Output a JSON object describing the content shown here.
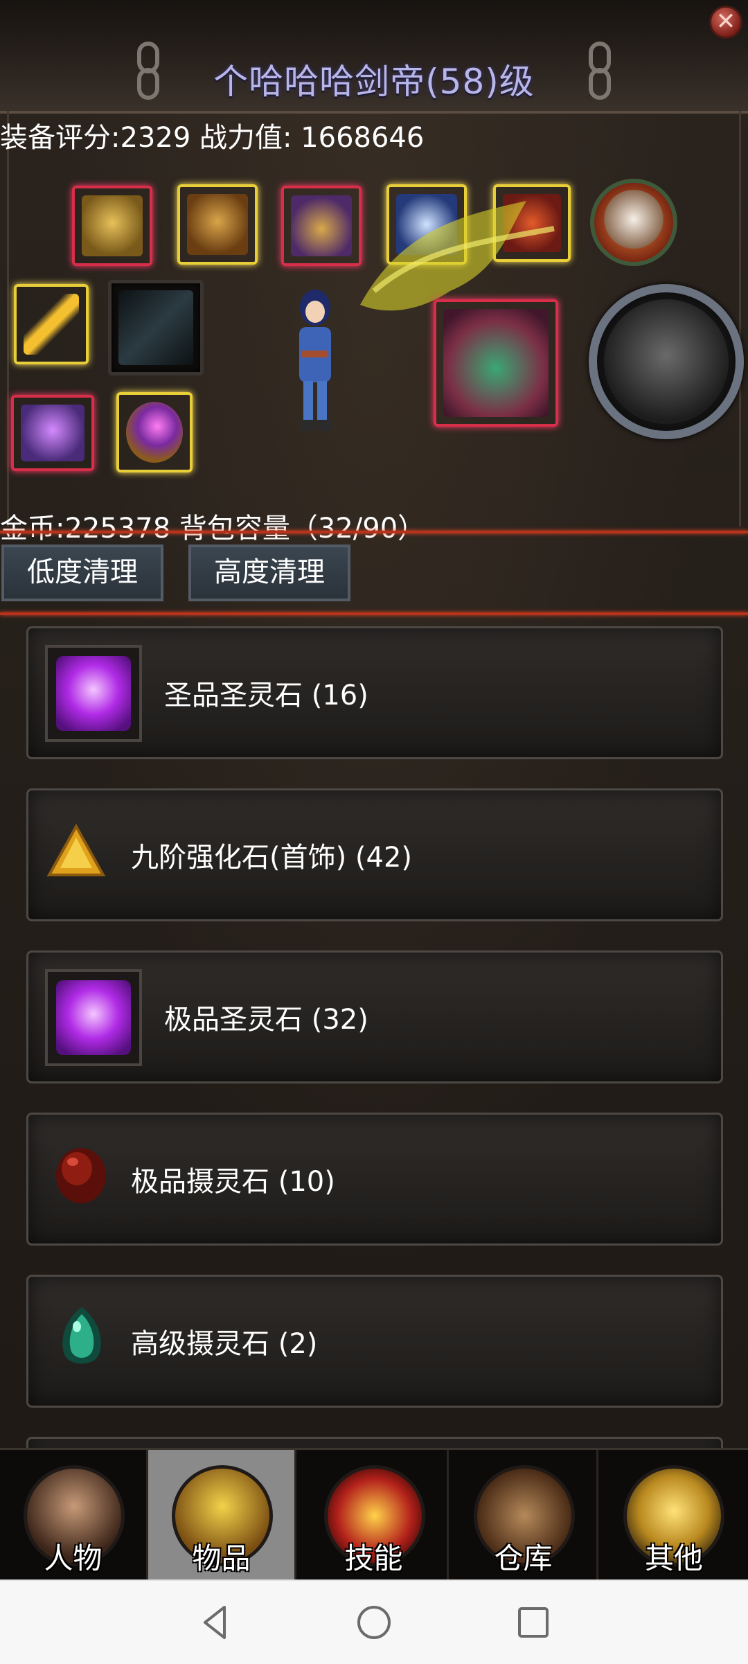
{
  "window": {
    "title": "个哈哈哈剑帝(58)级",
    "close_icon": "close-icon"
  },
  "stats": {
    "line": "装备评分:2329 战力值:  1668646"
  },
  "equipment": {
    "slots": [
      "helmet-icon",
      "armor-icon",
      "gauntlet-icon",
      "weapon-icon",
      "belt-icon",
      "medal-icon",
      "bracer-icon",
      "sword-icon",
      "necklace-icon",
      "ring-icon"
    ],
    "pet_icon": "dragon-pet-icon",
    "mount_icon": "tiger-mount-icon",
    "character_icon": "character-avatar"
  },
  "inventory": {
    "line": "金币:225378 背包容量（32/90）"
  },
  "buttons": {
    "low_clean": "低度清理",
    "high_clean": "高度清理"
  },
  "items": [
    {
      "name": "圣品圣灵石 (16)",
      "icon": "purple-spirit-stone-icon"
    },
    {
      "name": "九阶强化石(首饰) (42)",
      "icon": "gold-enhance-stone-icon"
    },
    {
      "name": "极品圣灵石 (32)",
      "icon": "purple-spirit-stone-icon"
    },
    {
      "name": "极品摄灵石 (10)",
      "icon": "red-soul-stone-icon"
    },
    {
      "name": "高级摄灵石 (2)",
      "icon": "green-soul-stone-icon"
    }
  ],
  "tabs": [
    {
      "label": "人物",
      "icon": "character-tab-icon"
    },
    {
      "label": "物品",
      "icon": "items-tab-icon",
      "active": true
    },
    {
      "label": "技能",
      "icon": "skills-tab-icon"
    },
    {
      "label": "仓库",
      "icon": "warehouse-tab-icon"
    },
    {
      "label": "其他",
      "icon": "trophy-tab-icon"
    }
  ],
  "colors": {
    "title": "#b8b5e8",
    "divider": "#b8331c",
    "active_tab": "#8a8a8a"
  }
}
